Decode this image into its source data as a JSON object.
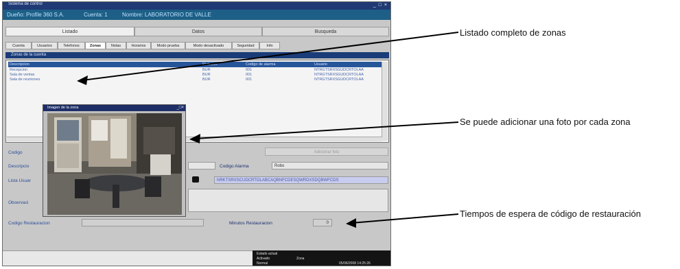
{
  "window": {
    "title": "Sistema de control",
    "controls": "_ □ ×",
    "info": {
      "owner": "Dueño: Profile 360 S.A.",
      "account": "Cuenta: 1",
      "name": "Nombre: LABORATORIO DE VALLE"
    }
  },
  "main_tabs": [
    {
      "label": "Listado",
      "active": true
    },
    {
      "label": "Datos",
      "active": false
    },
    {
      "label": "Busqueda",
      "active": false
    }
  ],
  "sub_tabs": [
    "Cuenta",
    "Usuarios",
    "Telefonos",
    "Zonas",
    "Notas",
    "Horarios",
    "Modo prueba",
    "Modo desactivado",
    "Seguridad",
    "Info"
  ],
  "active_sub_tab": "Zonas",
  "section_title": "Zonas de la cuenta",
  "list": {
    "headers": [
      "Descripcion",
      "Particion",
      "Codigo de alarma",
      "Usuario"
    ],
    "rows": [
      {
        "desc": "Recepcion",
        "part": "BUR",
        "code": "001",
        "user": "NTRGTSRXSGUDCRTOLAA"
      },
      {
        "desc": "Sala de ventas",
        "part": "BUR",
        "code": "001",
        "user": "NTRGTSRXSGUDCRTOLAA"
      },
      {
        "desc": "Sala de reuniones",
        "part": "BUR",
        "code": "001",
        "user": "NTRGTSRXSGUDCRTOLAA"
      }
    ]
  },
  "form": {
    "codigo_label": "Codigo",
    "descripcion_label": "Descripcio",
    "lista_label": "Lista Usuar",
    "observaciones_label": "Observaci",
    "foto_button": "Adicionar foto",
    "codigo_alarma_label": "Codigo Alarma",
    "codigo_alarma_value": "Robo",
    "lista_value": "NRKTSRXSCUDCRTOLABCAQBNFCDESQWRDXSDQBWFCDS",
    "codigo_restauracion_label": "Codigo Restauracion",
    "minutos_label": "Minutos Restauracion",
    "minutos_value": "0"
  },
  "popup": {
    "title": "Imagen de la zona"
  },
  "status_bar": {
    "estado_label": "Estado actual",
    "estado_value": "Activado",
    "state2_label": "Zona",
    "state2_value": "Normal",
    "datetime": "05/06/2008 14:25:26"
  },
  "annotations": [
    "Listado completo de zonas",
    "Se puede adicionar una foto por cada zona",
    "Tiempos de espera de código de restauración"
  ],
  "colors": {
    "title_bar": "#1f3a74",
    "info_bar": "#1d5f86",
    "section_bar": "#1a3c78"
  }
}
